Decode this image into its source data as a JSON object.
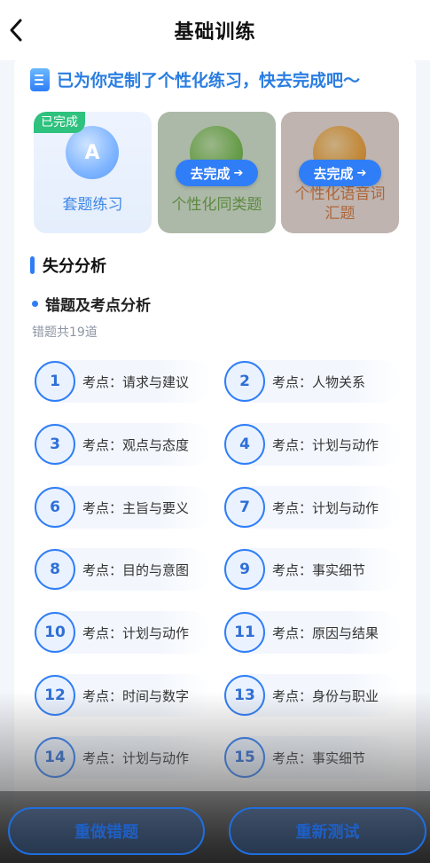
{
  "header": {
    "title": "基础训练"
  },
  "banner": {
    "text": "已为你定制了个性化练习，快去完成吧～"
  },
  "tiles": [
    {
      "label": "套题练习",
      "badge": "已完成",
      "emblem_letter": "A",
      "color": "#3d86e6"
    },
    {
      "label": "个性化同类题",
      "button": "去完成",
      "color": "#6aa843"
    },
    {
      "label": "个性化语音词汇题",
      "button": "去完成",
      "color": "#d9773a"
    }
  ],
  "section": {
    "title": "失分分析"
  },
  "mistakes": {
    "title": "错题及考点分析",
    "count_text": "错题共19道",
    "items": [
      {
        "num": "1",
        "label": "考点：请求与建议"
      },
      {
        "num": "2",
        "label": "考点：人物关系"
      },
      {
        "num": "3",
        "label": "考点：观点与态度"
      },
      {
        "num": "4",
        "label": "考点：计划与动作"
      },
      {
        "num": "6",
        "label": "考点：主旨与要义"
      },
      {
        "num": "7",
        "label": "考点：计划与动作"
      },
      {
        "num": "8",
        "label": "考点：目的与意图"
      },
      {
        "num": "9",
        "label": "考点：事实细节"
      },
      {
        "num": "10",
        "label": "考点：计划与动作"
      },
      {
        "num": "11",
        "label": "考点：原因与结果"
      },
      {
        "num": "12",
        "label": "考点：时间与数字"
      },
      {
        "num": "13",
        "label": "考点：身份与职业"
      },
      {
        "num": "14",
        "label": "考点：计划与动作"
      },
      {
        "num": "15",
        "label": "考点：事实细节"
      }
    ]
  },
  "footer": {
    "redo_label": "重做错题",
    "retest_label": "重新测试"
  },
  "colors": {
    "accent": "#2f7ef7",
    "done_badge": "#2ec27e"
  }
}
